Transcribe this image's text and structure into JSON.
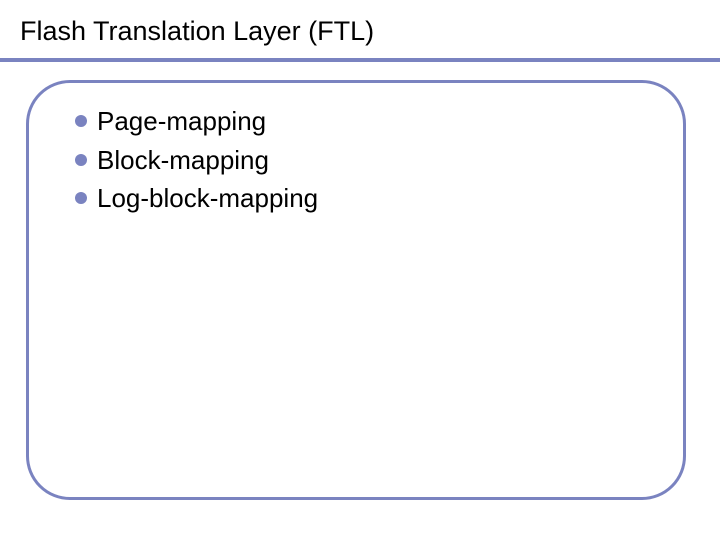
{
  "slide": {
    "title": "Flash Translation Layer (FTL)",
    "bullets": [
      "Page-mapping",
      "Block-mapping",
      "Log-block-mapping"
    ]
  },
  "colors": {
    "accent": "#7a83c0"
  }
}
